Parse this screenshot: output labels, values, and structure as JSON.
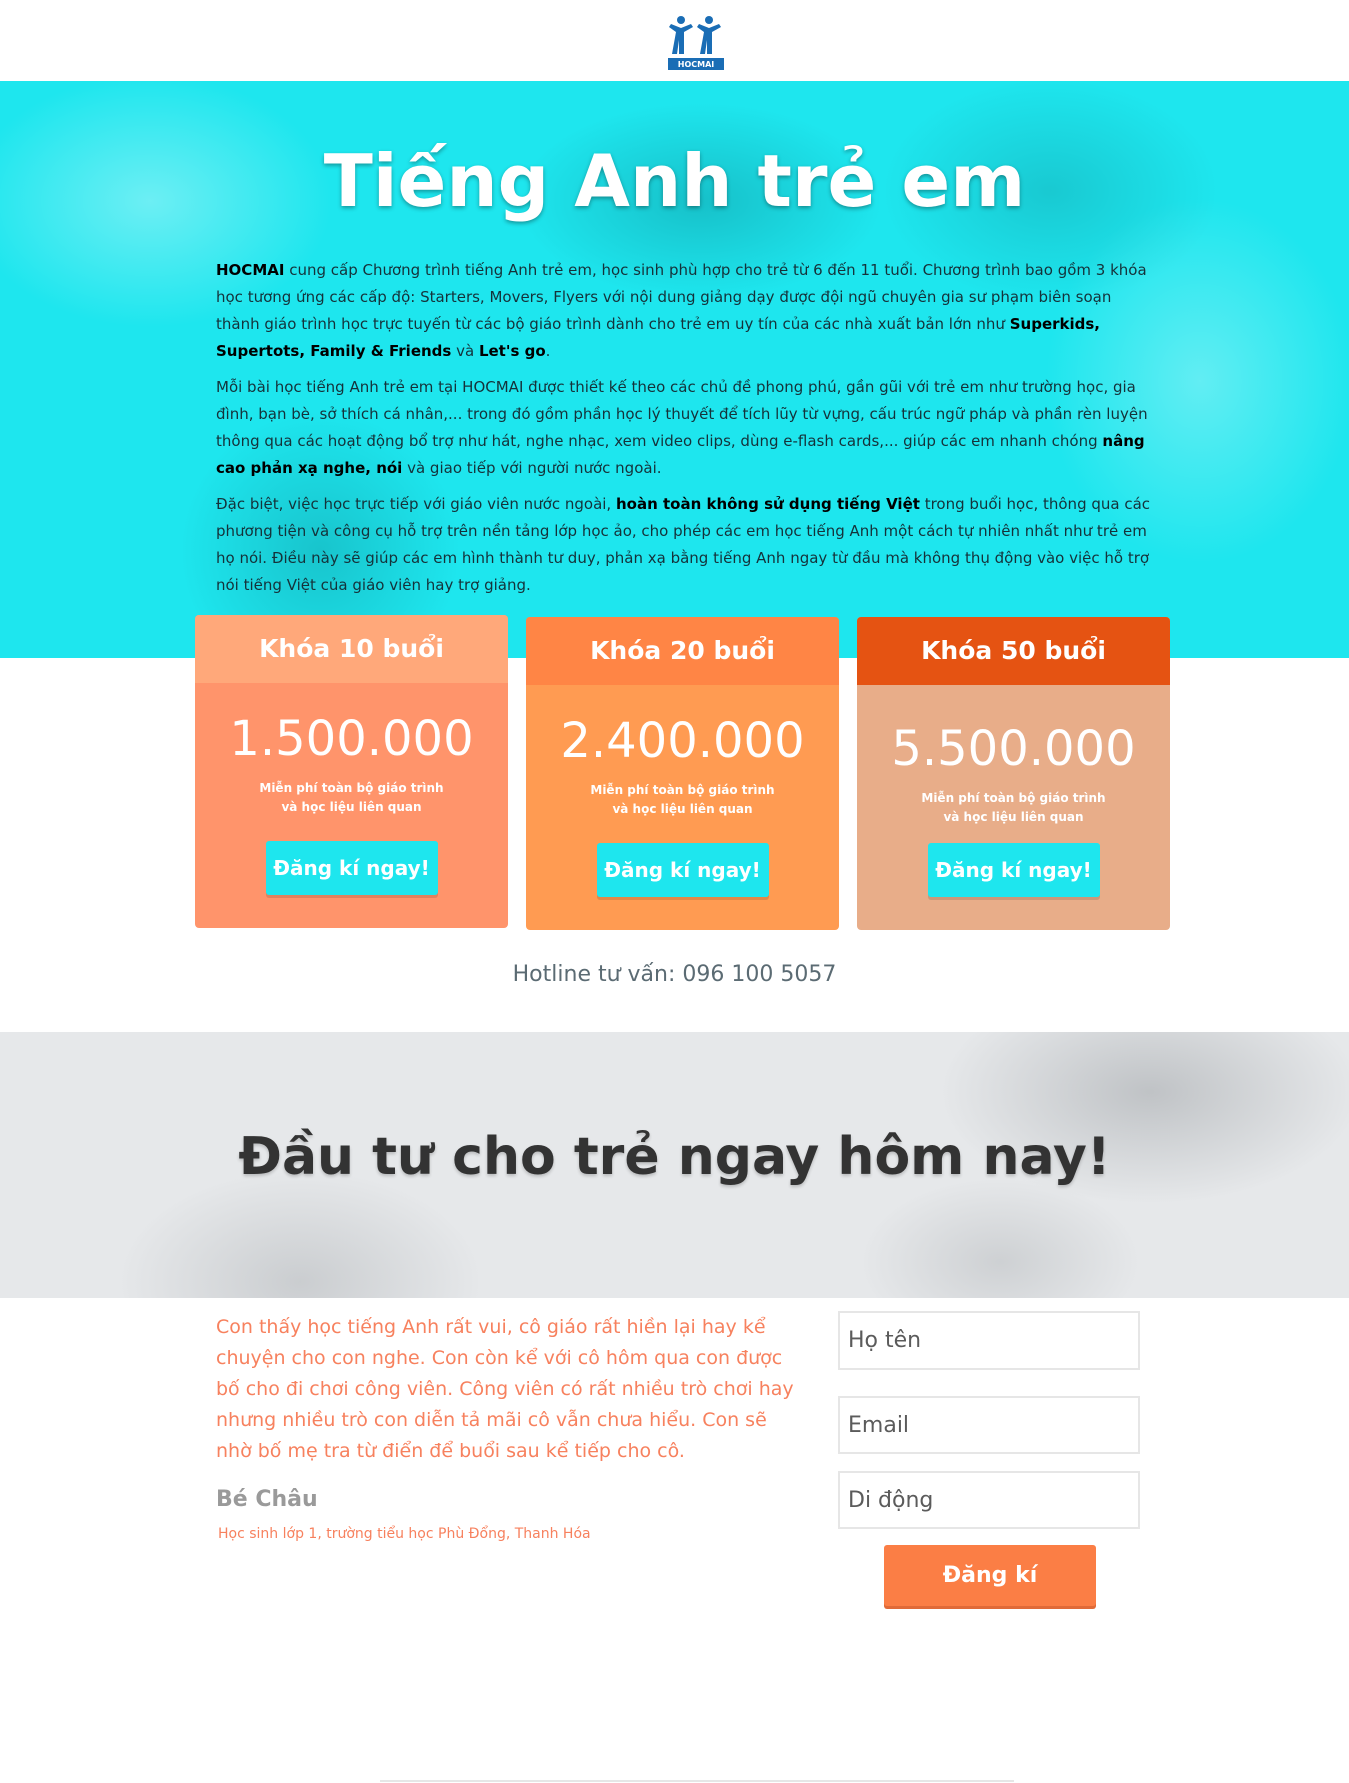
{
  "brand": {
    "logo_text": "HOCMAI",
    "logo_color": "#1a6db5"
  },
  "hero": {
    "title": "Tiếng Anh trẻ em",
    "p1": {
      "brand": "HOCMAI",
      "text1": " cung cấp Chương trình tiếng Anh trẻ em, học sinh phù hợp cho trẻ từ 6 đến 11 tuổi. Chương trình bao gồm 3 khóa học tương ứng các cấp độ: Starters, Movers, Flyers với nội dung giảng dạy được đội ngũ chuyên gia sư phạm biên soạn thành giáo trình học trực tuyến từ các bộ giáo trình dành cho trẻ em uy tín của các nhà xuất bản lớn như ",
      "books": "Superkids, Supertots, Family & Friends",
      "text2": " và ",
      "book_last": "Let's go",
      "text3": "."
    },
    "p2": {
      "text1": "Mỗi bài học tiếng Anh trẻ em tại HOCMAI được thiết kế theo các chủ đề phong phú, gần gũi với trẻ em như trường học, gia đình, bạn bè, sở thích cá nhân,... trong đó gồm phần học lý thuyết để tích lũy từ vựng, cấu trúc ngữ pháp và phần rèn luyện thông qua các hoạt động bổ trợ như hát, nghe nhạc, xem video clips, dùng e-flash cards,... giúp các em nhanh chóng ",
      "bold": "nâng cao phản xạ nghe, nói",
      "text2": " và giao tiếp với người nước ngoài."
    },
    "p3": {
      "text1": "Đặc biệt, việc học trực tiếp với giáo viên nước ngoài, ",
      "bold": "hoàn toàn không sử dụng tiếng Việt",
      "text2": " trong buổi học, thông qua các phương tiện và công cụ hỗ trợ trên nền tảng lớp học ảo, cho phép các em học tiếng Anh một cách tự nhiên nhất như trẻ em họ nói. Điều này sẽ giúp các em hình thành tư duy, phản xạ bằng tiếng Anh ngay từ đầu mà không thụ động vào việc hỗ trợ nói tiếng Việt của giáo viên hay trợ giảng."
    }
  },
  "pricing": [
    {
      "title": "Khóa 10 buổi",
      "price": "1.500.000",
      "note1": "Miễn phí toàn bộ giáo trình",
      "note2": "và học liệu liên quan",
      "button": "Đăng kí ngay!",
      "head_color": "#ffa87a",
      "body_color": "#ff946b"
    },
    {
      "title": "Khóa 20 buổi",
      "price": "2.400.000",
      "note1": "Miễn phí toàn bộ giáo trình",
      "note2": "và học liệu liên quan",
      "button": "Đăng kí ngay!",
      "head_color": "#ff8545",
      "body_color": "#ff9b52"
    },
    {
      "title": "Khóa 50 buổi",
      "price": "5.500.000",
      "note1": "Miễn phí toàn bộ giáo trình",
      "note2": "và học liệu liên quan",
      "button": "Đăng kí ngay!",
      "head_color": "#e55312",
      "body_color": "#e8ad89"
    }
  ],
  "hotline": "Hotline tư vấn: 096 100 5057",
  "invest": {
    "title": "Đầu tư cho trẻ ngay hôm nay!"
  },
  "testimonial": {
    "quote": "Con thấy học tiếng Anh rất vui, cô giáo rất hiền lại hay kể chuyện cho con nghe. Con còn kể với cô hôm qua con được bố cho đi chơi công viên. Công viên có rất nhiều trò chơi hay nhưng nhiều trò con diễn tả mãi cô vẫn chưa hiểu. Con sẽ nhờ bố mẹ tra từ điển để buổi sau kể tiếp cho cô.",
    "author": "Bé Châu",
    "author_info": "Học sinh lớp 1, trường tiểu học Phù Đổng, Thanh Hóa"
  },
  "form": {
    "name_placeholder": "Họ tên",
    "email_placeholder": "Email",
    "phone_placeholder": "Di động",
    "submit": "Đăng kí"
  },
  "colors": {
    "accent_cyan": "#1ee6ee",
    "accent_orange": "#fb7e45"
  }
}
